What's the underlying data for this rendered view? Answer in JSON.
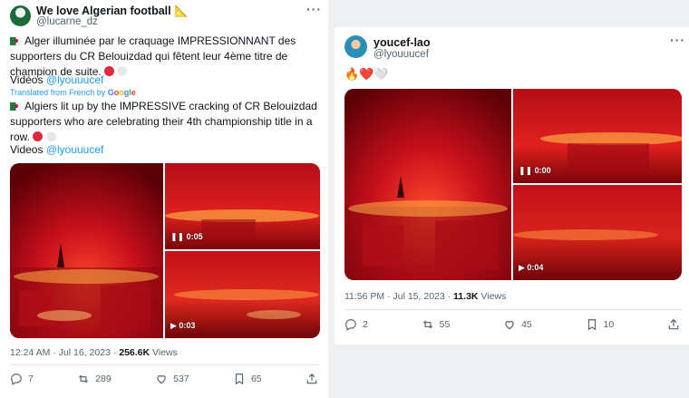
{
  "left_tweet": {
    "author_name": "We love Algerian football",
    "author_handle": "@lucarne_dz",
    "text_fr": "Alger illuminée par le craquage IMPRESSIONNANT des supporters du CR Belouizdad qui fêtent leur 4ème titre de champion de suite.",
    "videos_prefix_fr": "Vidéos ",
    "videos_credit": "@lyouuucef",
    "translated_prefix": "Translated from French by ",
    "translated_brand": "Google",
    "text_en": "Algiers lit up by the IMPRESSIVE cracking of CR Belouizdad supporters who are celebrating their 4th championship title in a row.",
    "videos_prefix_en": "Videos ",
    "videos_credit_en": "@lyouuucef",
    "video_timers": [
      "0:05",
      "0:03"
    ],
    "timestamp": "12:24 AM · Jul 16, 2023 · ",
    "views_count": "256.6K",
    "views_label": " Views",
    "actions": {
      "replies": "7",
      "retweets": "289",
      "likes": "537",
      "bookmarks": "65"
    }
  },
  "right_tweet": {
    "author_name": "youcef-lao",
    "author_handle": "@lyouuucef",
    "emojis": "🔥❤️🤍",
    "video_timers": [
      "0:00",
      "0:04"
    ],
    "timestamp": "11:56 PM · Jul 15, 2023 · ",
    "views_count": "11.3K",
    "views_label": " Views",
    "actions": {
      "replies": "2",
      "retweets": "55",
      "likes": "45",
      "bookmarks": "10"
    }
  },
  "more_glyph": "···",
  "colors": {
    "link": "#1d9bf0",
    "text": "#0f1419",
    "muted": "#536471",
    "fire": "#d2141e"
  }
}
